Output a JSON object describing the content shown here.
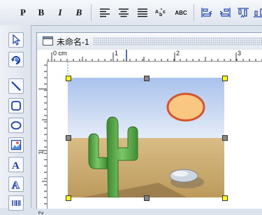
{
  "toolbar": {
    "buttons": [
      {
        "name": "plain-text-button",
        "label": "P"
      },
      {
        "name": "bold-button",
        "label": "B"
      },
      {
        "name": "italic-button",
        "label": "I"
      },
      {
        "name": "bold-italic-button",
        "label": "B"
      },
      {
        "name": "align-left-icon"
      },
      {
        "name": "align-center-icon"
      },
      {
        "name": "justify-icon"
      },
      {
        "name": "text-spacing-icon"
      },
      {
        "name": "text-case-button",
        "label": "ABC"
      },
      {
        "name": "align-left-edge-icon"
      },
      {
        "name": "align-right-edge-icon"
      },
      {
        "name": "align-top-edge-icon"
      },
      {
        "name": "align-bottom-edge-icon"
      }
    ]
  },
  "document": {
    "title": "未命名-1",
    "ruler_unit": "cm",
    "hruler_labels": [
      "0 cm",
      "1",
      "2",
      "3"
    ],
    "vruler_labels": [
      "1",
      "2"
    ]
  },
  "tools": [
    "select-arrow-icon",
    "rotate-icon",
    "line-icon",
    "rounded-rect-icon",
    "ellipse-icon",
    "image-icon",
    "text-icon",
    "outline-text-icon",
    "barcode-icon"
  ],
  "colors": {
    "accent": "#1a3fb0",
    "handle_fill": "#ffff00",
    "sky": "#bcd1f2",
    "sand": "#d6b77b",
    "cactus": "#5cae4a",
    "sun": "#f8c77d",
    "sun_outline": "#d8572e"
  }
}
